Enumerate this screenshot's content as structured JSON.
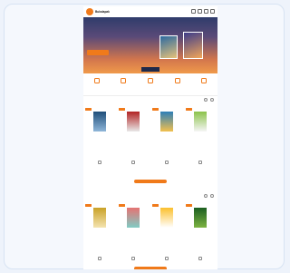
{
  "header": {
    "brand": "Bukalapak",
    "icons": [
      "search-icon",
      "cart-icon",
      "heart-icon",
      "menu-icon"
    ]
  },
  "banner": {
    "headline": "",
    "subtext": "",
    "button_label": "",
    "price": ""
  },
  "categories": [
    {
      "icon": "grid-icon",
      "label": ""
    },
    {
      "icon": "book-icon",
      "label": ""
    },
    {
      "icon": "tag-icon",
      "label": ""
    },
    {
      "icon": "star-icon",
      "label": ""
    },
    {
      "icon": "gift-icon",
      "label": ""
    }
  ],
  "sections": [
    {
      "title": "",
      "books": [
        {
          "title": "",
          "price": "",
          "cover": [
            "#1f4e79",
            "#8fb6d9"
          ]
        },
        {
          "title": "",
          "price": "",
          "cover": [
            "#b22222",
            "#e8e8e8"
          ]
        },
        {
          "title": "",
          "price": "",
          "cover": [
            "#2c7fb8",
            "#f2c14e"
          ]
        },
        {
          "title": "",
          "price": "",
          "cover": [
            "#8bc34a",
            "#f5f5f5"
          ]
        }
      ]
    },
    {
      "title": "",
      "books": [
        {
          "title": "",
          "price": "",
          "cover": [
            "#c9a227",
            "#f4e4b0"
          ]
        },
        {
          "title": "",
          "price": "",
          "cover": [
            "#e57373",
            "#80cbc4"
          ]
        },
        {
          "title": "",
          "price": "",
          "cover": [
            "#fbc02d",
            "#ffffff"
          ]
        },
        {
          "title": "",
          "price": "",
          "cover": [
            "#1b5e20",
            "#7cb342"
          ]
        }
      ]
    }
  ],
  "colors": {
    "accent": "#f07a1a",
    "background": "#eef3fb"
  }
}
